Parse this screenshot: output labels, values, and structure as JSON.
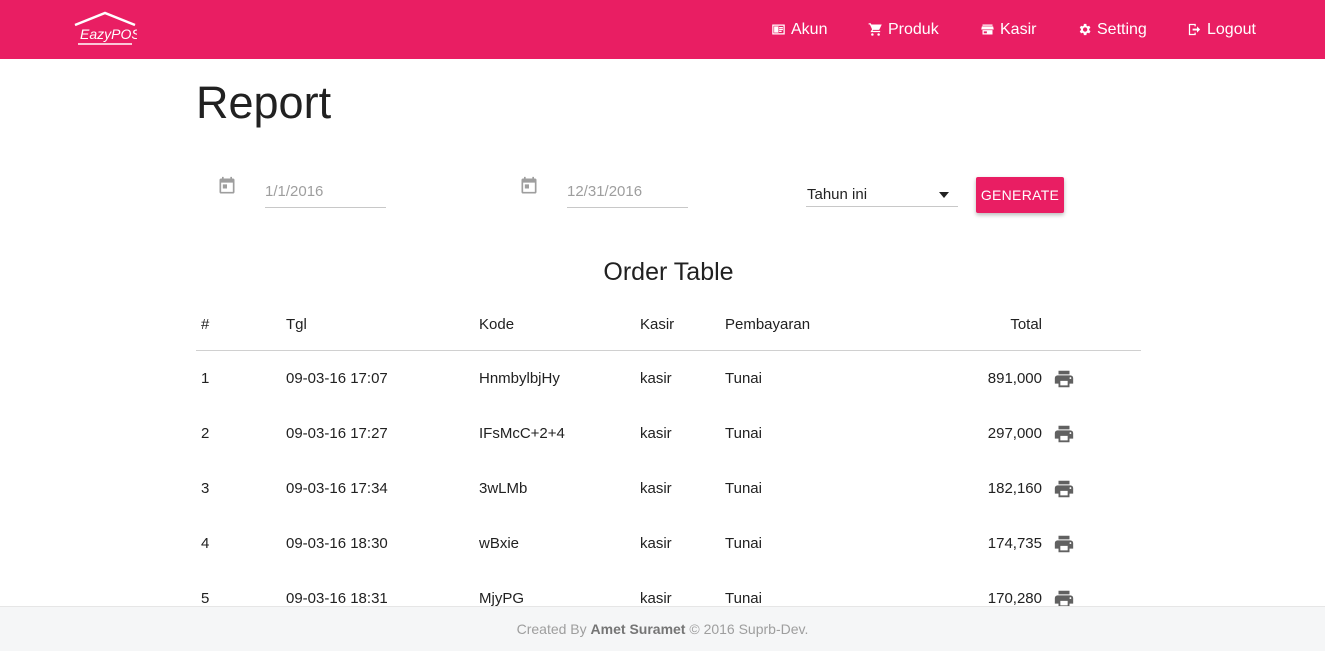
{
  "brand": {
    "logo_text": "EazyPOS",
    "accent_color": "#e91e63"
  },
  "nav": {
    "items": [
      {
        "label": "Akun",
        "icon": "account-card-icon"
      },
      {
        "label": "Produk",
        "icon": "cart-icon"
      },
      {
        "label": "Kasir",
        "icon": "store-icon"
      },
      {
        "label": "Setting",
        "icon": "gear-icon"
      },
      {
        "label": "Logout",
        "icon": "logout-icon"
      }
    ]
  },
  "page": {
    "title": "Report"
  },
  "filters": {
    "start_date": {
      "placeholder": "1/1/2016",
      "icon": "calendar-icon"
    },
    "end_date": {
      "placeholder": "12/31/2016",
      "icon": "calendar-icon"
    },
    "period": {
      "selected": "Tahun ini"
    },
    "generate_label": "Generate"
  },
  "order_table": {
    "title": "Order Table",
    "columns": [
      "#",
      "Tgl",
      "Kode",
      "Kasir",
      "Pembayaran",
      "Total"
    ],
    "rows": [
      {
        "no": "1",
        "tgl": "09-03-16 17:07",
        "kode": "HnmbylbjHy",
        "kasir": "kasir",
        "pembayaran": "Tunai",
        "total": "891,000"
      },
      {
        "no": "2",
        "tgl": "09-03-16 17:27",
        "kode": "IFsMcC+2+4",
        "kasir": "kasir",
        "pembayaran": "Tunai",
        "total": "297,000"
      },
      {
        "no": "3",
        "tgl": "09-03-16 17:34",
        "kode": "3wLMb",
        "kasir": "kasir",
        "pembayaran": "Tunai",
        "total": "182,160"
      },
      {
        "no": "4",
        "tgl": "09-03-16 18:30",
        "kode": "wBxie",
        "kasir": "kasir",
        "pembayaran": "Tunai",
        "total": "174,735"
      },
      {
        "no": "5",
        "tgl": "09-03-16 18:31",
        "kode": "MjyPG",
        "kasir": "kasir",
        "pembayaran": "Tunai",
        "total": "170,280"
      }
    ],
    "row_action_icon": "print-icon"
  },
  "footer": {
    "prefix": "Created By",
    "author": "Amet Suramet",
    "suffix": "© 2016 Suprb-Dev."
  }
}
